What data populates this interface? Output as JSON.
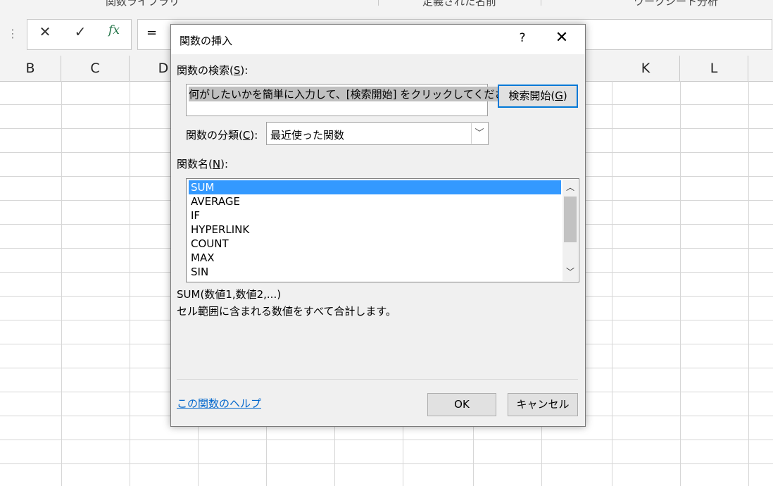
{
  "ribbon": {
    "groups": [
      "関数ライブラリ",
      "定義された名前",
      "ワークシート分析"
    ]
  },
  "formula_bar": {
    "cancel_icon": "✕",
    "enter_icon": "✓",
    "fx_label": "fx",
    "equals": "="
  },
  "columns": [
    "B",
    "C",
    "D",
    "K",
    "L"
  ],
  "dialog": {
    "title": "関数の挿入",
    "help_label": "?",
    "close_label": "✕",
    "search_label": "関数の検索(S):",
    "search_label_pre": "関数の検索(",
    "search_label_key": "S",
    "search_label_post": "):",
    "search_value": "何がしたいかを簡単に入力して、[検索開始] をクリックしてください。",
    "search_button_pre": "検索開始(",
    "search_button_key": "G",
    "search_button_post": ")",
    "category_label_pre": "関数の分類(",
    "category_label_key": "C",
    "category_label_post": "):",
    "category_value": "最近使った関数",
    "function_list_label_pre": "関数名(",
    "function_list_label_key": "N",
    "function_list_label_post": "):",
    "functions": [
      "SUM",
      "AVERAGE",
      "IF",
      "HYPERLINK",
      "COUNT",
      "MAX",
      "SIN"
    ],
    "selected_function": "SUM",
    "syntax": "SUM(数値1,数値2,...)",
    "description": "セル範囲に含まれる数値をすべて合計します。",
    "help_link": "この関数のヘルプ",
    "ok_label": "OK",
    "cancel_label": "キャンセル"
  }
}
